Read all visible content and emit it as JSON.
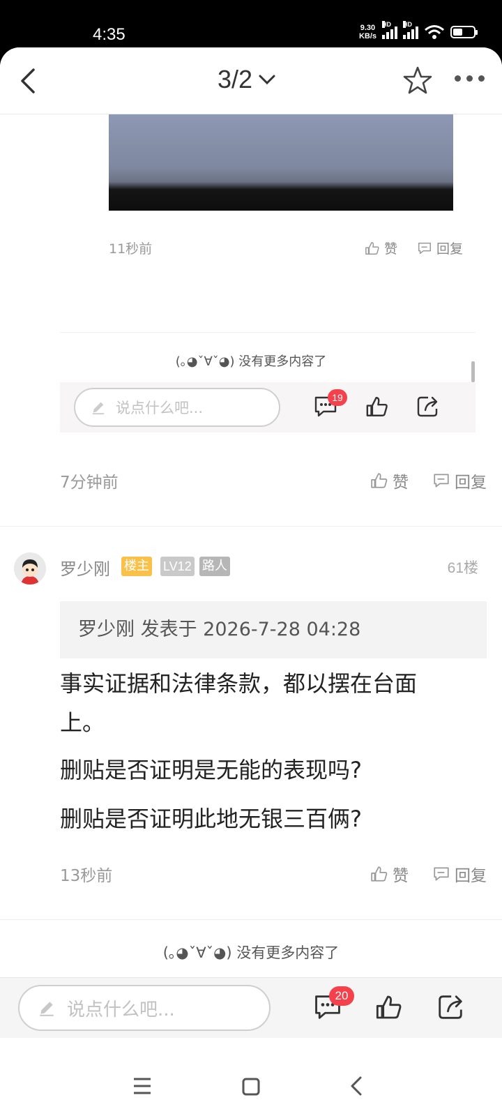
{
  "status_bar": {
    "time": "4:35",
    "net_speed_value": "9.30",
    "net_speed_unit": "KB/s",
    "hd1": "HD",
    "hd2": "HD",
    "battery_level": 0.4
  },
  "nav": {
    "title": "3/2"
  },
  "embedded": {
    "comment_time": "11秒前",
    "like_label": "赞",
    "reply_label": "回复",
    "no_more": "(｡◕ˇ∀ˇ◕) 没有更多内容了",
    "input_placeholder": "说点什么吧...",
    "comment_count": "19"
  },
  "prev_comment": {
    "time": "7分钟前",
    "like_label": "赞",
    "reply_label": "回复"
  },
  "post": {
    "username": "罗少刚",
    "tags": [
      "楼主",
      "LV12",
      "路人"
    ],
    "floor": "61楼",
    "quote": "罗少刚 发表于 2026-7-28 04:28",
    "paragraphs": [
      "事实证据和法律条款，都以摆在台面上。",
      "删贴是否证明是无能的表现吗?",
      "删贴是否证明此地无银三百俩?"
    ],
    "time": "13秒前",
    "like_label": "赞",
    "reply_label": "回复"
  },
  "footer": {
    "no_more": "(｡◕ˇ∀ˇ◕) 没有更多内容了"
  },
  "bottom_bar": {
    "input_placeholder": "说点什么吧...",
    "comment_count": "20"
  },
  "colors": {
    "tag_owner": "#f9c14a",
    "tag_level": "#c9c9c9",
    "tag_role": "#b6b6b6",
    "badge": "#f5414b"
  }
}
